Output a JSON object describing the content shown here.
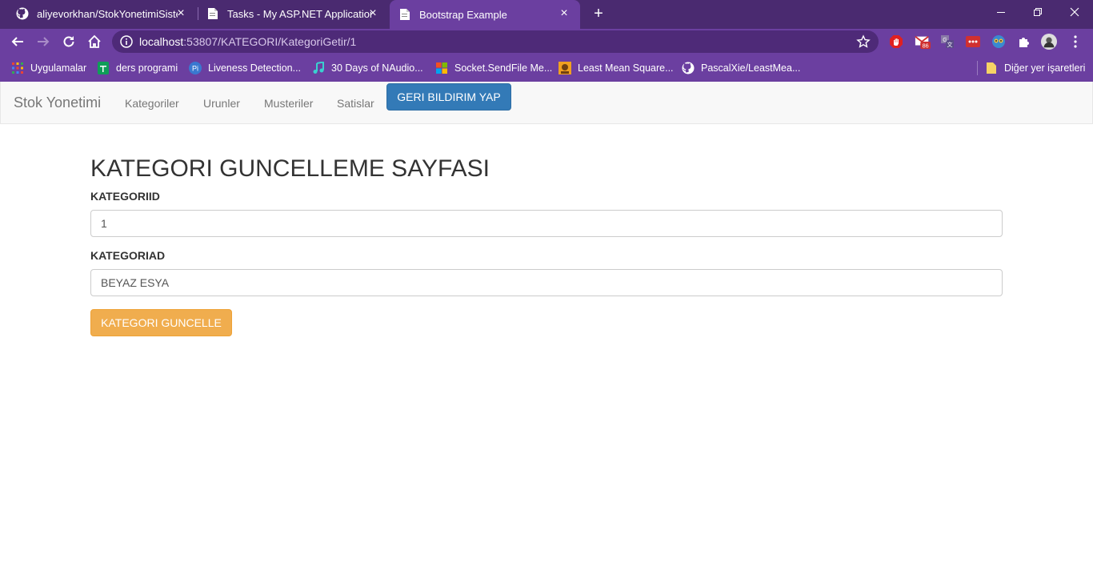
{
  "browser": {
    "tabs": [
      {
        "title": "aliyevorkhan/StokYonetimiSistem",
        "icon": "github-icon",
        "active": false
      },
      {
        "title": "Tasks - My ASP.NET Application",
        "icon": "page-icon",
        "active": false
      },
      {
        "title": "Bootstrap Example",
        "icon": "page-icon",
        "active": true
      }
    ],
    "new_tab": "+",
    "url_host": "localhost",
    "url_path": ":53807/KATEGORI/KategoriGetir/1",
    "extensions": [
      {
        "name": "adblock-icon"
      },
      {
        "name": "mail-icon",
        "badge": "86"
      },
      {
        "name": "translate-icon"
      },
      {
        "name": "ellipsis-ext-icon"
      },
      {
        "name": "owl-icon"
      },
      {
        "name": "puzzle-icon"
      },
      {
        "name": "profile-avatar-icon"
      },
      {
        "name": "kebab-menu-icon"
      }
    ],
    "bookmarks": [
      {
        "label": "Uygulamalar",
        "icon": "apps-grid-icon"
      },
      {
        "label": "ders programi",
        "icon": "sheet-icon"
      },
      {
        "label": "Liveness Detection...",
        "icon": "pyimage-icon"
      },
      {
        "label": "30 Days of NAudio...",
        "icon": "music-icon"
      },
      {
        "label": "Socket.SendFile Me...",
        "icon": "microsoft-icon"
      },
      {
        "label": "Least Mean Square...",
        "icon": "site-icon"
      },
      {
        "label": "PascalXie/LeastMea...",
        "icon": "github-icon"
      }
    ],
    "other_bookmarks": "Diğer yer işaretleri"
  },
  "navbar": {
    "brand": "Stok Yonetimi",
    "links": [
      "Kategoriler",
      "Urunler",
      "Musteriler",
      "Satislar"
    ],
    "feedback_button": "GERI BILDIRIM YAP"
  },
  "form": {
    "title": "KATEGORI GUNCELLEME SAYFASI",
    "fields": [
      {
        "label": "KATEGORIID",
        "value": "1"
      },
      {
        "label": "KATEGORIAD",
        "value": "BEYAZ ESYA"
      }
    ],
    "submit": "KATEGORI GUNCELLE"
  },
  "colors": {
    "chrome_dark": "#4a2a70",
    "chrome": "#6b3fa0",
    "primary_button": "#337ab7",
    "warning_button": "#f0ad4e"
  }
}
